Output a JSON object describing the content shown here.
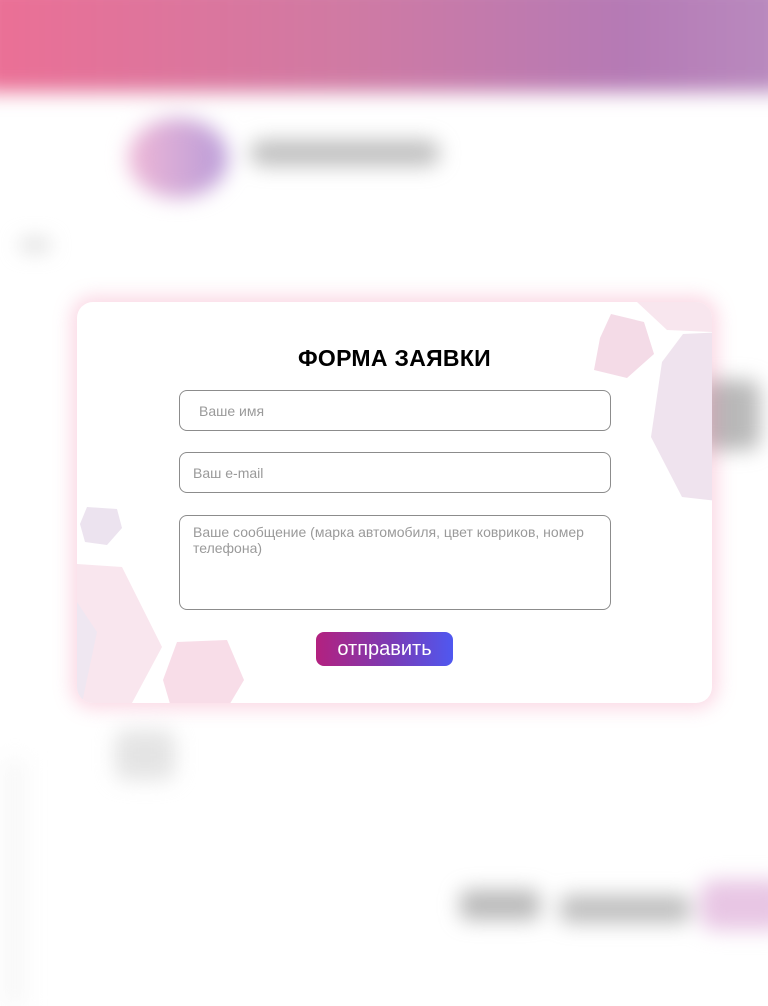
{
  "modal": {
    "title": "ФОРМА ЗАЯВКИ",
    "name_placeholder": "Ваше имя",
    "email_placeholder": "Ваш e-mail",
    "message_placeholder": "Ваше сообщение (марка автомобиля, цвет ковриков, номер телефона)",
    "submit_label": "отправить"
  },
  "colors": {
    "header_gradient_start": "#ec6f95",
    "header_gradient_end": "#b98bbf",
    "button_gradient_start": "#b3217f",
    "button_gradient_end": "#4f58f0",
    "modal_glow": "#f078a0"
  }
}
